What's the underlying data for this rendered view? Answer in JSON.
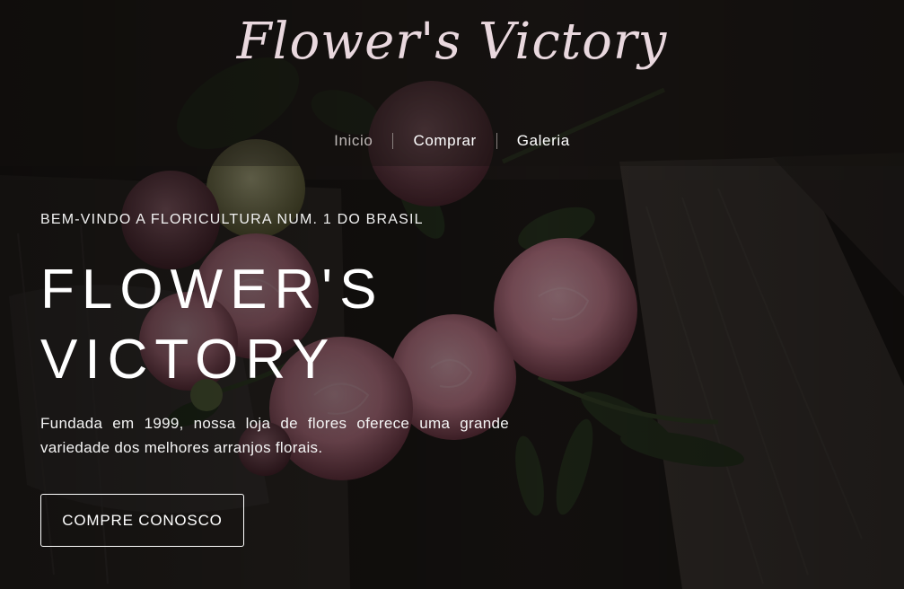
{
  "colors": {
    "background_dark": "#1f1a18",
    "rose_pink": "#d98a9c",
    "leaf_green": "#2f3a26",
    "logo_color": "#e9d8de",
    "nav_active": "#bdb7b5"
  },
  "header": {
    "logo_text": "Flower's Victory",
    "nav": [
      {
        "label": "Inicio",
        "active": true
      },
      {
        "label": "Comprar",
        "active": false
      },
      {
        "label": "Galeria",
        "active": false
      }
    ]
  },
  "hero": {
    "welcome": "BEM-VINDO A FLORICULTURA NUM. 1 DO BRASIL",
    "title_line1": "FLOWER'S",
    "title_line2": "VICTORY",
    "description": "Fundada em 1999, nossa loja de flores oferece uma grande variedade dos melhores arranjos florais.",
    "cta_label": "COMPRE CONOSCO"
  }
}
